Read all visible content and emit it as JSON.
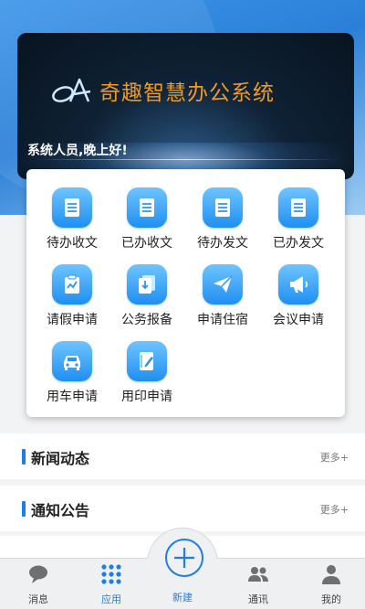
{
  "banner": {
    "brand_name": "奇趣智慧办公系统",
    "greeting": "系统人员,晚上好!"
  },
  "apps": [
    {
      "label": "待办收文",
      "icon": "document-icon"
    },
    {
      "label": "已办收文",
      "icon": "document-icon"
    },
    {
      "label": "待办发文",
      "icon": "document-icon"
    },
    {
      "label": "已办发文",
      "icon": "document-icon"
    },
    {
      "label": "请假申请",
      "icon": "leave-clipboard-icon"
    },
    {
      "label": "公务报备",
      "icon": "report-download-icon"
    },
    {
      "label": "申请住宿",
      "icon": "paper-plane-icon"
    },
    {
      "label": "会议申请",
      "icon": "megaphone-icon"
    },
    {
      "label": "用车申请",
      "icon": "car-icon"
    },
    {
      "label": "用印申请",
      "icon": "notebook-pen-icon"
    }
  ],
  "sections": [
    {
      "title": "新闻动态",
      "more": "更多+"
    },
    {
      "title": "通知公告",
      "more": "更多+"
    }
  ],
  "tabbar": {
    "items": [
      {
        "label": "消息",
        "icon": "chat-bubble-icon"
      },
      {
        "label": "应用",
        "icon": "app-grid-icon"
      },
      {
        "label": "新建",
        "icon": "plus-icon"
      },
      {
        "label": "通讯",
        "icon": "contacts-icon"
      },
      {
        "label": "我的",
        "icon": "user-icon"
      }
    ],
    "active": "应用"
  },
  "colors": {
    "accent": "#1f7fe0",
    "brand_text": "#f29a1f",
    "header_bg": "#3d96e8"
  }
}
